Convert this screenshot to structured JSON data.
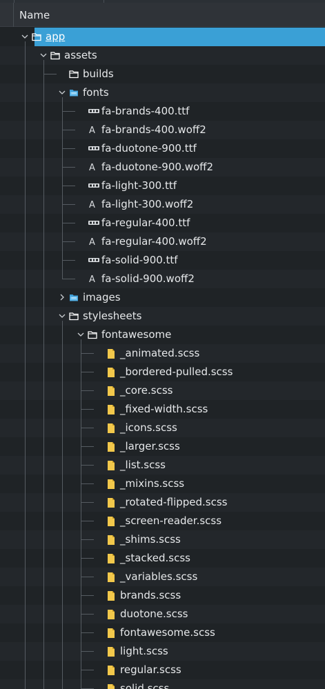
{
  "header": {
    "name_label": "Name"
  },
  "tree": {
    "rows": [
      {
        "label": "app",
        "type": "folder",
        "depth": 0,
        "expander": "open",
        "selected": true
      },
      {
        "label": "assets",
        "type": "folder",
        "depth": 1,
        "expander": "open"
      },
      {
        "label": "builds",
        "type": "folder",
        "depth": 2,
        "expander": "none"
      },
      {
        "label": "fonts",
        "type": "folder-blue",
        "depth": 2,
        "expander": "open"
      },
      {
        "label": "fa-brands-400.ttf",
        "type": "ttf",
        "depth": 3,
        "expander": "none"
      },
      {
        "label": "fa-brands-400.woff2",
        "type": "font",
        "depth": 3,
        "expander": "none"
      },
      {
        "label": "fa-duotone-900.ttf",
        "type": "ttf",
        "depth": 3,
        "expander": "none"
      },
      {
        "label": "fa-duotone-900.woff2",
        "type": "font",
        "depth": 3,
        "expander": "none"
      },
      {
        "label": "fa-light-300.ttf",
        "type": "ttf",
        "depth": 3,
        "expander": "none"
      },
      {
        "label": "fa-light-300.woff2",
        "type": "font",
        "depth": 3,
        "expander": "none"
      },
      {
        "label": "fa-regular-400.ttf",
        "type": "ttf",
        "depth": 3,
        "expander": "none"
      },
      {
        "label": "fa-regular-400.woff2",
        "type": "font",
        "depth": 3,
        "expander": "none"
      },
      {
        "label": "fa-solid-900.ttf",
        "type": "ttf",
        "depth": 3,
        "expander": "none"
      },
      {
        "label": "fa-solid-900.woff2",
        "type": "font",
        "depth": 3,
        "expander": "none"
      },
      {
        "label": "images",
        "type": "folder-blue",
        "depth": 2,
        "expander": "closed"
      },
      {
        "label": "stylesheets",
        "type": "folder",
        "depth": 2,
        "expander": "open"
      },
      {
        "label": "fontawesome",
        "type": "folder",
        "depth": 3,
        "expander": "open"
      },
      {
        "label": "_animated.scss",
        "type": "scss",
        "depth": 4,
        "expander": "none"
      },
      {
        "label": "_bordered-pulled.scss",
        "type": "scss",
        "depth": 4,
        "expander": "none"
      },
      {
        "label": "_core.scss",
        "type": "scss",
        "depth": 4,
        "expander": "none"
      },
      {
        "label": "_fixed-width.scss",
        "type": "scss",
        "depth": 4,
        "expander": "none"
      },
      {
        "label": "_icons.scss",
        "type": "scss",
        "depth": 4,
        "expander": "none"
      },
      {
        "label": "_larger.scss",
        "type": "scss",
        "depth": 4,
        "expander": "none"
      },
      {
        "label": "_list.scss",
        "type": "scss",
        "depth": 4,
        "expander": "none"
      },
      {
        "label": "_mixins.scss",
        "type": "scss",
        "depth": 4,
        "expander": "none"
      },
      {
        "label": "_rotated-flipped.scss",
        "type": "scss",
        "depth": 4,
        "expander": "none"
      },
      {
        "label": "_screen-reader.scss",
        "type": "scss",
        "depth": 4,
        "expander": "none"
      },
      {
        "label": "_shims.scss",
        "type": "scss",
        "depth": 4,
        "expander": "none"
      },
      {
        "label": "_stacked.scss",
        "type": "scss",
        "depth": 4,
        "expander": "none"
      },
      {
        "label": "_variables.scss",
        "type": "scss",
        "depth": 4,
        "expander": "none"
      },
      {
        "label": "brands.scss",
        "type": "scss",
        "depth": 4,
        "expander": "none"
      },
      {
        "label": "duotone.scss",
        "type": "scss",
        "depth": 4,
        "expander": "none"
      },
      {
        "label": "fontawesome.scss",
        "type": "scss",
        "depth": 4,
        "expander": "none"
      },
      {
        "label": "light.scss",
        "type": "scss",
        "depth": 4,
        "expander": "none"
      },
      {
        "label": "regular.scss",
        "type": "scss",
        "depth": 4,
        "expander": "none"
      },
      {
        "label": "solid.scss",
        "type": "scss",
        "depth": 4,
        "expander": "none"
      }
    ]
  },
  "colors": {
    "selection": "#3aa0d6",
    "folder_icon": "#ffffff",
    "folder_blue_icon": "#3f9fd8",
    "scss_icon": "#f2c84b",
    "guide_line": "#565c62"
  }
}
